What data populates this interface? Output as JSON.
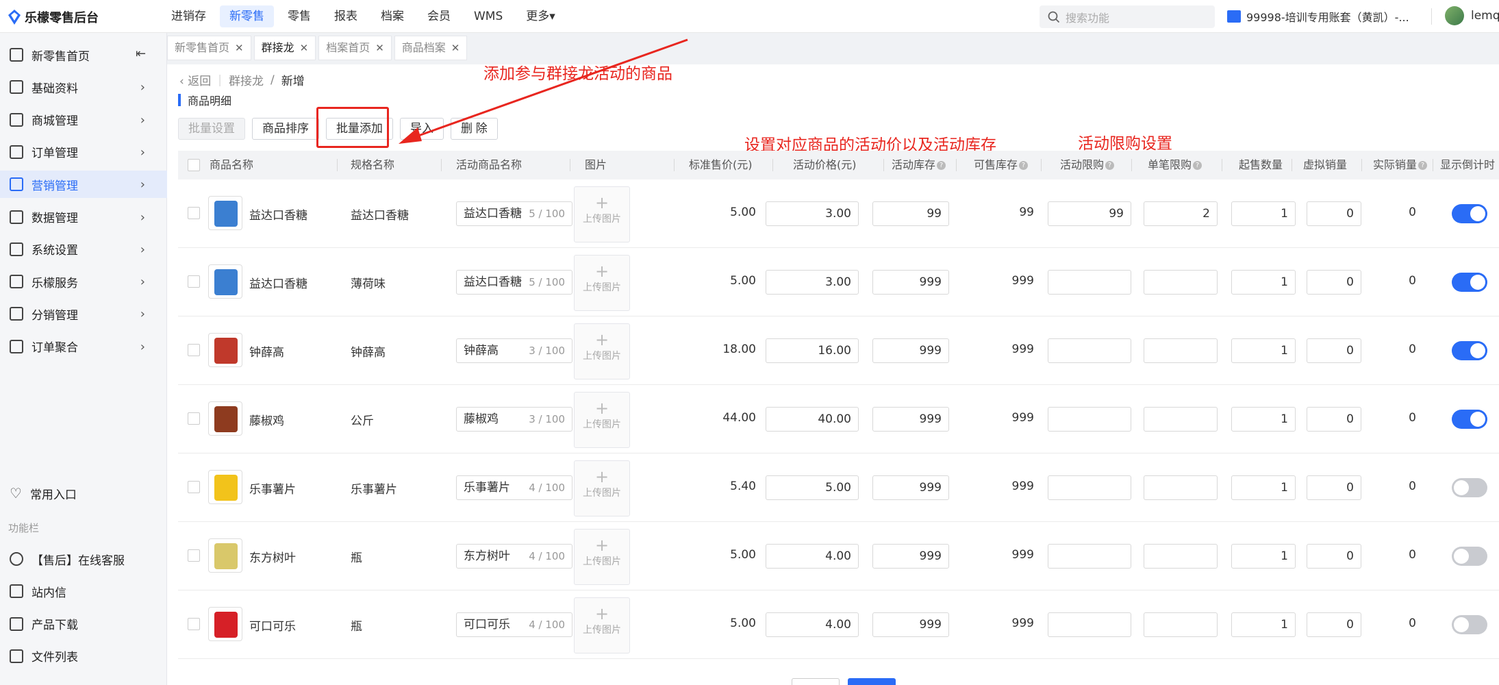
{
  "app": {
    "title": "乐檬零售后台"
  },
  "topnav": {
    "items": [
      "进销存",
      "新零售",
      "零售",
      "报表",
      "档案",
      "会员",
      "WMS",
      "更多▾"
    ],
    "active_index": 1
  },
  "search": {
    "placeholder": "搜索功能"
  },
  "account": {
    "name": "99998-培训专用账套（黄凯）-..."
  },
  "user": {
    "name": "lemq"
  },
  "sidebar": {
    "items": [
      {
        "label": "新零售首页",
        "icon": "home-icon"
      },
      {
        "label": "基础资料",
        "icon": "grid-icon"
      },
      {
        "label": "商城管理",
        "icon": "store-icon"
      },
      {
        "label": "订单管理",
        "icon": "order-icon"
      },
      {
        "label": "营销管理",
        "icon": "marketing-icon"
      },
      {
        "label": "数据管理",
        "icon": "chart-icon"
      },
      {
        "label": "系统设置",
        "icon": "gear-icon"
      },
      {
        "label": "乐檬服务",
        "icon": "service-icon"
      },
      {
        "label": "分销管理",
        "icon": "distribution-icon"
      },
      {
        "label": "订单聚合",
        "icon": "aggregate-icon"
      }
    ],
    "common_entry": "常用入口",
    "function_bar": "功能栏",
    "bottom_items": [
      "【售后】在线客服",
      "站内信",
      "产品下载",
      "文件列表"
    ]
  },
  "tabs": [
    {
      "label": "新零售首页"
    },
    {
      "label": "群接龙"
    },
    {
      "label": "档案首页"
    },
    {
      "label": "商品档案"
    }
  ],
  "breadcrumb": {
    "back": "返回",
    "parent": "群接龙",
    "current": "新增"
  },
  "section": {
    "title": "商品明细"
  },
  "toolbar": {
    "batch_set": "批量设置",
    "sort": "商品排序",
    "batch_add": "批量添加",
    "import": "导入",
    "delete": "删 除"
  },
  "annotations": {
    "add_goods": "添加参与群接龙活动的商品",
    "set_price": "设置对应商品的活动价以及活动库存",
    "limit": "活动限购设置"
  },
  "table": {
    "headers": [
      "商品名称",
      "规格名称",
      "活动商品名称",
      "图片",
      "标准售价(元)",
      "活动价格(元)",
      "活动库存",
      "可售库存",
      "活动限购",
      "单笔限购",
      "起售数量",
      "虚拟销量",
      "实际销量",
      "显示倒计时"
    ],
    "upload_label": "上传图片",
    "rows": [
      {
        "name": "益达口香糖",
        "spec": "益达口香糖",
        "act_name": "益达口香糖",
        "count": "5 / 100",
        "std_price": "5.00",
        "act_price": "3.00",
        "act_stock": "99",
        "sale_stock": "99",
        "limit": "99",
        "single_limit": "2",
        "min_qty": "1",
        "virtual": "0",
        "actual": "0",
        "toggle": true,
        "thumb_color": "#3b7fd1"
      },
      {
        "name": "益达口香糖",
        "spec": "薄荷味",
        "act_name": "益达口香糖",
        "count": "5 / 100",
        "std_price": "5.00",
        "act_price": "3.00",
        "act_stock": "999",
        "sale_stock": "999",
        "limit": "",
        "single_limit": "",
        "min_qty": "1",
        "virtual": "0",
        "actual": "0",
        "toggle": true,
        "thumb_color": "#3b7fd1"
      },
      {
        "name": "钟薛高",
        "spec": "钟薛高",
        "act_name": "钟薛高",
        "count": "3 / 100",
        "std_price": "18.00",
        "act_price": "16.00",
        "act_stock": "999",
        "sale_stock": "999",
        "limit": "",
        "single_limit": "",
        "min_qty": "1",
        "virtual": "0",
        "actual": "0",
        "toggle": true,
        "thumb_color": "#c0392b"
      },
      {
        "name": "藤椒鸡",
        "spec": "公斤",
        "act_name": "藤椒鸡",
        "count": "3 / 100",
        "std_price": "44.00",
        "act_price": "40.00",
        "act_stock": "999",
        "sale_stock": "999",
        "limit": "",
        "single_limit": "",
        "min_qty": "1",
        "virtual": "0",
        "actual": "0",
        "toggle": true,
        "thumb_color": "#8e3b1f"
      },
      {
        "name": "乐事薯片",
        "spec": "乐事薯片",
        "act_name": "乐事薯片",
        "count": "4 / 100",
        "std_price": "5.40",
        "act_price": "5.00",
        "act_stock": "999",
        "sale_stock": "999",
        "limit": "",
        "single_limit": "",
        "min_qty": "1",
        "virtual": "0",
        "actual": "0",
        "toggle": false,
        "thumb_color": "#f2c31b"
      },
      {
        "name": "东方树叶",
        "spec": "瓶",
        "act_name": "东方树叶",
        "count": "4 / 100",
        "std_price": "5.00",
        "act_price": "4.00",
        "act_stock": "999",
        "sale_stock": "999",
        "limit": "",
        "single_limit": "",
        "min_qty": "1",
        "virtual": "0",
        "actual": "0",
        "toggle": false,
        "thumb_color": "#d9c86a"
      },
      {
        "name": "可口可乐",
        "spec": "瓶",
        "act_name": "可口可乐",
        "count": "4 / 100",
        "std_price": "5.00",
        "act_price": "4.00",
        "act_stock": "999",
        "sale_stock": "999",
        "limit": "",
        "single_limit": "",
        "min_qty": "1",
        "virtual": "0",
        "actual": "0",
        "toggle": false,
        "thumb_color": "#d62027"
      }
    ]
  },
  "colors": {
    "accent": "#2a6cf6",
    "annotation": "#e8261f"
  }
}
